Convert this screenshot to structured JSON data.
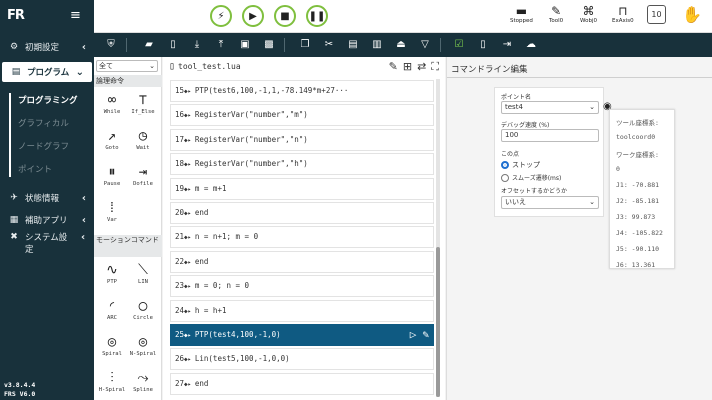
{
  "app": {
    "logo": "FR",
    "version_line1": "v3.8.4.4",
    "version_line2": "FRS V6.0"
  },
  "sidebar": {
    "items": [
      {
        "label": "初期設定",
        "icon": "gear-icon"
      },
      {
        "label": "プログラム",
        "icon": "program-icon"
      },
      {
        "label": "状態情報",
        "icon": "status-icon"
      },
      {
        "label": "補助アプリ",
        "icon": "apps-icon"
      },
      {
        "label": "システム設定",
        "icon": "tools-icon"
      }
    ],
    "sub_items": [
      "プログラミング",
      "グラフィカル",
      "ノードグラフ",
      "ポイント"
    ]
  },
  "topbar": {
    "stopped_label": "Stopped",
    "tool_label": "Tool0",
    "wobj_label": "Wobj0",
    "exaxis_label": "ExAxis0",
    "speed_value": "10"
  },
  "palette": {
    "filter_value": "全て",
    "section_logic": "論理命令",
    "section_motion": "モーションコマンド",
    "logic_commands": [
      "While",
      "If_Else",
      "Goto",
      "Wait",
      "Pause",
      "Dofile",
      "Var"
    ],
    "motion_commands": [
      "PTP",
      "LIN",
      "ARC",
      "Circle",
      "Spiral",
      "N-Spiral",
      "H-Spiral",
      "Spline"
    ]
  },
  "editor": {
    "file_name": "tool_test.lua",
    "lines": [
      {
        "num": "15",
        "code": "PTP(test6,100,-1,1,-78.149*m+27···"
      },
      {
        "num": "16",
        "code": "RegisterVar(\"number\",\"m\")"
      },
      {
        "num": "17",
        "code": "RegisterVar(\"number\",\"n\")"
      },
      {
        "num": "18",
        "code": "RegisterVar(\"number\",\"h\")"
      },
      {
        "num": "19",
        "code": "m = m+1"
      },
      {
        "num": "20",
        "code": "end"
      },
      {
        "num": "21",
        "code": "n = n+1; m = 0"
      },
      {
        "num": "22",
        "code": "end"
      },
      {
        "num": "23",
        "code": "m = 0; n = 0"
      },
      {
        "num": "24",
        "code": "h = h+1"
      },
      {
        "num": "25",
        "code": "PTP(test4,100,-1,0)"
      },
      {
        "num": "26",
        "code": "Lin(test5,100,-1,0,0)"
      },
      {
        "num": "27",
        "code": "end"
      }
    ],
    "selected_line": "25"
  },
  "command_panel": {
    "title": "コマンドライン編集",
    "point_label": "ポイント名",
    "point_value": "test4",
    "speed_label": "デバッグ速度 (%)",
    "speed_value": "100",
    "stop_label": "この点",
    "radio_stop": "ストップ",
    "radio_smooth": "スムーズ遷移(ms)",
    "offset_label": "オフセットするかどうか",
    "offset_value": "いいえ"
  },
  "info_panel": {
    "tool_coord_label": "ツール座標系:",
    "tool_coord_value": "toolcoord0",
    "work_coord_label": "ワーク座標系:",
    "work_coord_value": "0",
    "joints": [
      "J1: -70.881",
      "J2: -85.181",
      "J3: 99.873",
      "J4: -105.822",
      "J5: -90.110",
      "J6: 13.361"
    ]
  }
}
